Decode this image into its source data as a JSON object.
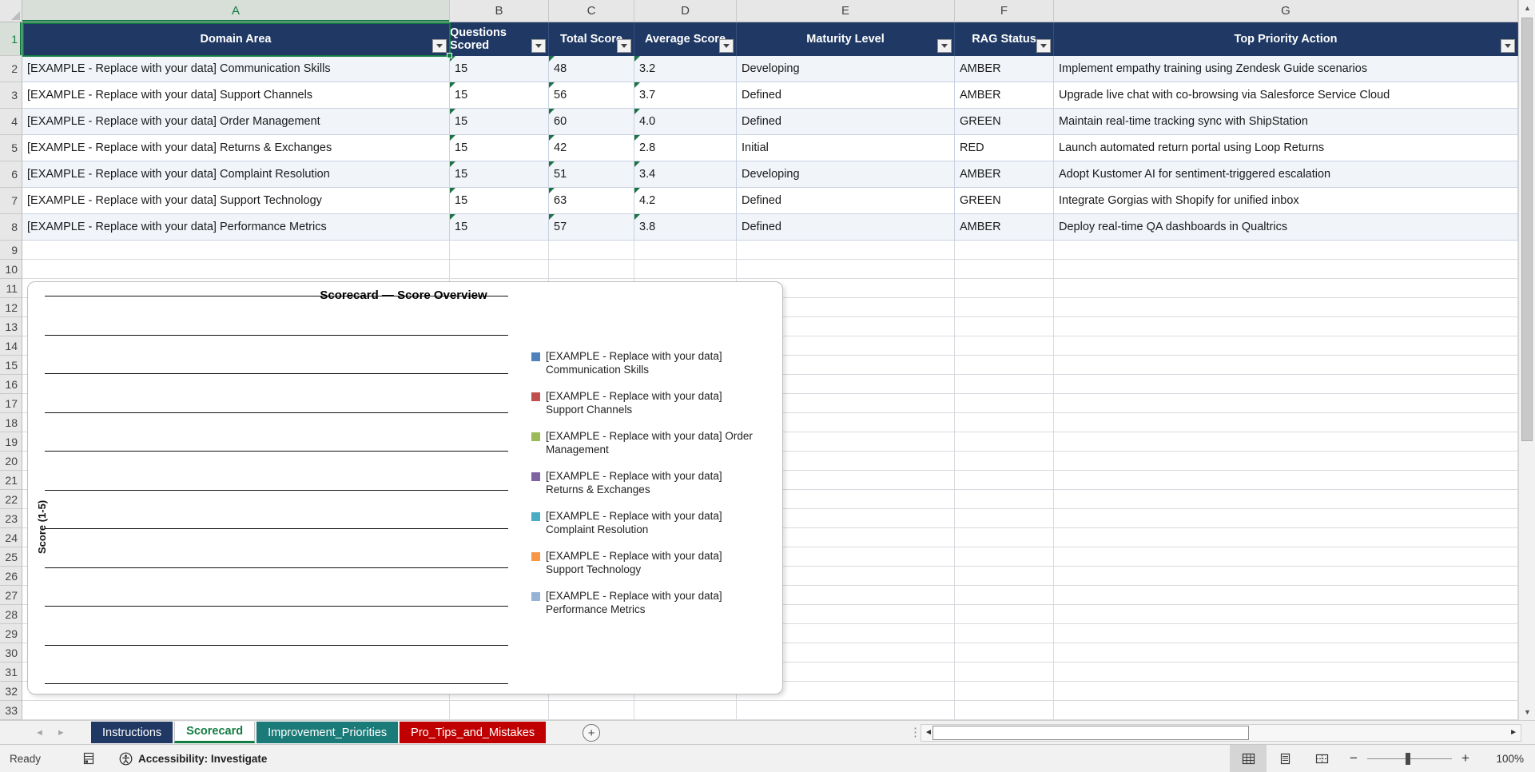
{
  "sheet": {
    "column_letters": [
      "A",
      "B",
      "C",
      "D",
      "E",
      "F",
      "G"
    ],
    "row_numbers": [
      "1",
      "2",
      "3",
      "4",
      "5",
      "6",
      "7",
      "8",
      "9",
      "10",
      "11",
      "12",
      "13",
      "14",
      "15",
      "16",
      "17",
      "18",
      "19",
      "20",
      "21",
      "22",
      "23",
      "24",
      "25",
      "26",
      "27",
      "28",
      "29",
      "30",
      "31",
      "32",
      "33"
    ],
    "selected_cell": "A1"
  },
  "table": {
    "headers": [
      "Domain Area",
      "Questions Scored",
      "Total Score",
      "Average Score",
      "Maturity Level",
      "RAG Status",
      "Top Priority Action"
    ],
    "rows": [
      [
        "[EXAMPLE - Replace with your data] Communication Skills",
        "15",
        "48",
        "3.2",
        "Developing",
        "AMBER",
        "Implement empathy training using Zendesk Guide scenarios"
      ],
      [
        "[EXAMPLE - Replace with your data] Support Channels",
        "15",
        "56",
        "3.7",
        "Defined",
        "AMBER",
        "Upgrade live chat with co-browsing via Salesforce Service Cloud"
      ],
      [
        "[EXAMPLE - Replace with your data] Order Management",
        "15",
        "60",
        "4.0",
        "Defined",
        "GREEN",
        "Maintain real-time tracking sync with ShipStation"
      ],
      [
        "[EXAMPLE - Replace with your data] Returns & Exchanges",
        "15",
        "42",
        "2.8",
        "Initial",
        "RED",
        "Launch automated return portal using Loop Returns"
      ],
      [
        "[EXAMPLE - Replace with your data] Complaint Resolution",
        "15",
        "51",
        "3.4",
        "Developing",
        "AMBER",
        "Adopt Kustomer AI for sentiment-triggered escalation"
      ],
      [
        "[EXAMPLE - Replace with your data] Support Technology",
        "15",
        "63",
        "4.2",
        "Defined",
        "GREEN",
        "Integrate Gorgias with Shopify for unified inbox"
      ],
      [
        "[EXAMPLE - Replace with your data] Performance Metrics",
        "15",
        "57",
        "3.8",
        "Defined",
        "AMBER",
        "Deploy real-time QA dashboards in Qualtrics"
      ]
    ]
  },
  "chart_data": {
    "type": "bar",
    "title": "Scorecard — Score Overview",
    "ylabel": "Score (1-5)",
    "plot_area_empty": true,
    "gridline_count": 11,
    "legend_position": "right",
    "series": [
      {
        "name": "[EXAMPLE - Replace with your data] Communication Skills",
        "color": "#4F81BD",
        "legend_lines": [
          "[EXAMPLE - Replace with your data]",
          "Communication Skills"
        ]
      },
      {
        "name": "[EXAMPLE - Replace with your data] Support Channels",
        "color": "#C0504D",
        "legend_lines": [
          "[EXAMPLE - Replace with your data]",
          "Support Channels"
        ]
      },
      {
        "name": "[EXAMPLE - Replace with your data] Order Management",
        "color": "#9BBB59",
        "legend_lines": [
          "[EXAMPLE - Replace with your data] Order",
          "Management"
        ]
      },
      {
        "name": "[EXAMPLE - Replace with your data] Returns & Exchanges",
        "color": "#8064A2",
        "legend_lines": [
          "[EXAMPLE - Replace with your data]",
          "Returns & Exchanges"
        ]
      },
      {
        "name": "[EXAMPLE - Replace with your data] Complaint Resolution",
        "color": "#4BACC6",
        "legend_lines": [
          "[EXAMPLE - Replace with your data]",
          "Complaint Resolution"
        ]
      },
      {
        "name": "[EXAMPLE - Replace with your data] Support Technology",
        "color": "#F79646",
        "legend_lines": [
          "[EXAMPLE - Replace with your data]",
          "Support Technology"
        ]
      },
      {
        "name": "[EXAMPLE - Replace with your data] Performance Metrics",
        "color": "#95B3D7",
        "legend_lines": [
          "[EXAMPLE - Replace with your data]",
          "Performance Metrics"
        ]
      }
    ]
  },
  "tabs": {
    "items": [
      {
        "label": "Instructions",
        "color": "#1F3864",
        "text_color": "#FFFFFF",
        "active": false
      },
      {
        "label": "Scorecard",
        "color": "#FFFFFF",
        "text_color": "#107C41",
        "active": true
      },
      {
        "label": "Improvement_Priorities",
        "color": "#1B7B79",
        "text_color": "#FFFFFF",
        "active": false
      },
      {
        "label": "Pro_Tips_and_Mistakes",
        "color": "#C00000",
        "text_color": "#FFFFFF",
        "active": false
      }
    ]
  },
  "status_bar": {
    "mode": "Ready",
    "accessibility_label": "Accessibility: Investigate",
    "zoom_percent": "100%"
  },
  "colors": {
    "table_header_bg": "#1F3864",
    "selection_green": "#107C41",
    "banded_row": "#F1F5FA",
    "rag_values": [
      "AMBER",
      "GREEN",
      "RED"
    ]
  }
}
